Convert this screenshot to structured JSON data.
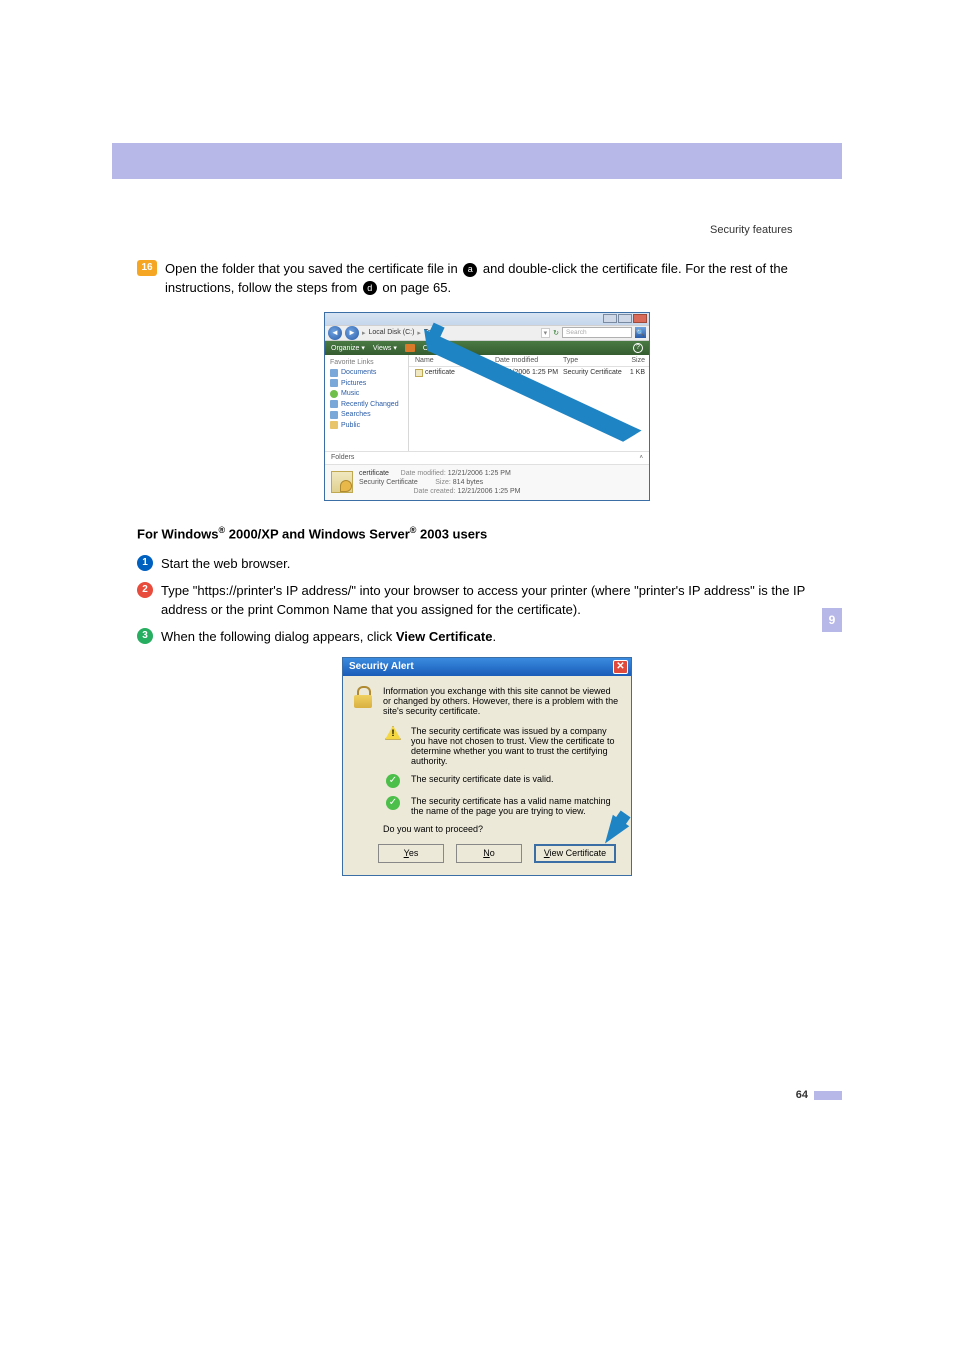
{
  "header": {
    "section": "Security features"
  },
  "step16": {
    "num": "16",
    "text_a": "Open the folder that you saved the certificate file in ",
    "ref_a": "a",
    "text_b": " and double-click the certificate file. For the rest of the instructions, follow the steps from ",
    "ref_d": "d",
    "text_c": " on page 65."
  },
  "explorer": {
    "path_parts": [
      "Local Disk (C:)",
      "Temp"
    ],
    "search_placeholder": "Search",
    "toolbar": {
      "organize": "Organize ▾",
      "views": "Views ▾",
      "open": "Open ▾"
    },
    "sidebar_label": "Favorite Links",
    "sidebar_items": [
      "Documents",
      "Pictures",
      "Music",
      "Recently Changed",
      "Searches",
      "Public"
    ],
    "folders_label": "Folders",
    "columns": {
      "name": "Name",
      "date": "Date modified",
      "type": "Type",
      "size": "Size"
    },
    "row": {
      "name": "certificate",
      "date": "12/21/2006 1:25 PM",
      "type": "Security Certificate",
      "size": "1 KB"
    },
    "footer": {
      "name": "certificate",
      "type": "Security Certificate",
      "dm_label": "Date modified:",
      "dm": "12/21/2006 1:25 PM",
      "sz_label": "Size:",
      "sz": "814 bytes",
      "dc_label": "Date created:",
      "dc": "12/21/2006 1:25 PM"
    }
  },
  "subhead": {
    "a": "For Windows",
    "b": " 2000/XP and Windows Server",
    "c": " 2003 users",
    "reg": "®"
  },
  "step1": {
    "num": "1",
    "text": "Start the web browser."
  },
  "step2": {
    "num": "2",
    "text": "Type \"https://printer's IP address/\" into your browser to access your printer (where \"printer's IP address\" is the IP address or the print Common Name that you assigned for the certificate)."
  },
  "step3": {
    "num": "3",
    "text_a": "When the following dialog appears, click ",
    "bold": "View Certificate",
    "text_b": "."
  },
  "secalert": {
    "title": "Security Alert",
    "intro": "Information you exchange with this site cannot be viewed or changed by others. However, there is a problem with the site's security certificate.",
    "warn": "The security certificate was issued by a company you have not chosen to trust. View the certificate to determine whether you want to trust the certifying authority.",
    "ok1": "The security certificate date is valid.",
    "ok2": "The security certificate has a valid name matching the name of the page you are trying to view.",
    "question": "Do you want to proceed?",
    "btn_yes": "Yes",
    "btn_no": "No",
    "btn_view": "View Certificate"
  },
  "sidetab": "9",
  "pagenum": "64"
}
